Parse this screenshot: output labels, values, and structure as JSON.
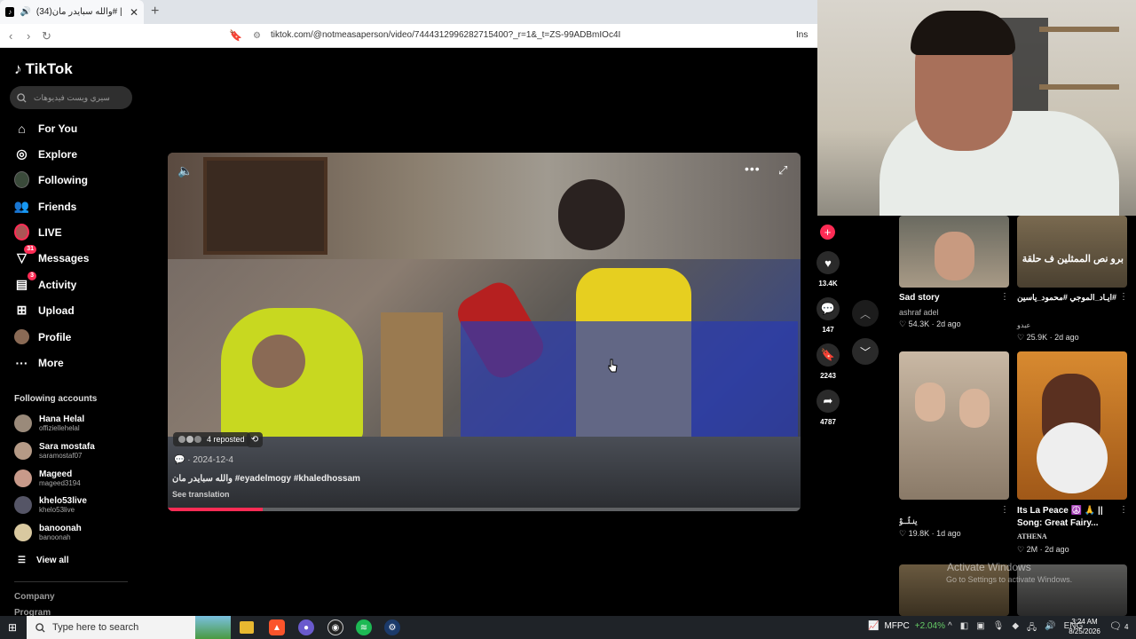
{
  "browser": {
    "tab_title": "(34)والله سبايدر مان# | TikTok",
    "new_tab": "+",
    "url": "tiktok.com/@notmeasaperson/video/7444312996282715400?_r=1&_t=ZS-99ADBmIOc4I",
    "extension_label": "Ins"
  },
  "sidebar": {
    "logo": "TikTok",
    "search_placeholder": "سيري ويست فيديوهات",
    "nav": [
      {
        "label": "For You",
        "icon": "home-icon"
      },
      {
        "label": "Explore",
        "icon": "compass-icon"
      },
      {
        "label": "Following",
        "icon": "following-avatar-icon"
      },
      {
        "label": "Friends",
        "icon": "friends-icon"
      },
      {
        "label": "LIVE",
        "icon": "live-icon"
      },
      {
        "label": "Messages",
        "icon": "messages-icon",
        "badge": "31"
      },
      {
        "label": "Activity",
        "icon": "activity-icon",
        "badge": "3"
      },
      {
        "label": "Upload",
        "icon": "upload-icon"
      },
      {
        "label": "Profile",
        "icon": "profile-avatar-icon"
      },
      {
        "label": "More",
        "icon": "more-dots-icon"
      }
    ],
    "following_title": "Following accounts",
    "accounts": [
      {
        "name": "Hana Helal",
        "handle": "offiziellehelal"
      },
      {
        "name": "Sara mostafa",
        "handle": "saramostaf07"
      },
      {
        "name": "Mageed",
        "handle": "mageed3194"
      },
      {
        "name": "khelo53live",
        "handle": "khelo53live"
      },
      {
        "name": "banoonah",
        "handle": "banoonah"
      }
    ],
    "view_all": "View all",
    "footer_company": "Company",
    "footer_program": "Program"
  },
  "video": {
    "reposted_label": "4 reposted",
    "date": "· 2024-12-4",
    "caption": "والله سبايدر مان #eyadelmogy #khaledhossam",
    "see_translation": "See translation",
    "progress_fraction": 0.15
  },
  "actions": {
    "likes": "13.4K",
    "comments": "147",
    "saves": "2243",
    "shares": "4787"
  },
  "grid": [
    {
      "title": "Sad story",
      "author": "ashraf adel",
      "likes": "54.3K",
      "age": "2d ago"
    },
    {
      "title": "#ايـاد_الموجي #محمود_ياسين #البيت_الممتاز",
      "author": "عبدو",
      "likes": "25.9K",
      "age": "2d ago",
      "thumb_text": "برو نص الممثلين ف حلقة"
    },
    {
      "title": "ينـثُــوْ",
      "author": "",
      "likes": "19.8K",
      "age": "1d ago"
    },
    {
      "title": "Its La Peace ☮️ 🙏 || Song: Great Fairy...",
      "author": "ATHENA",
      "likes": "2M",
      "age": "2d ago"
    }
  ],
  "windows_watermark": {
    "line1": "Activate Windows",
    "line2": "Go to Settings to activate Windows."
  },
  "taskbar": {
    "search_placeholder": "Type here to search",
    "stock_name": "MFPC",
    "stock_change": "+2.04%",
    "lang": "ENG",
    "time": "3:24 AM",
    "date": "8/25/2026",
    "notif_count": "4"
  }
}
